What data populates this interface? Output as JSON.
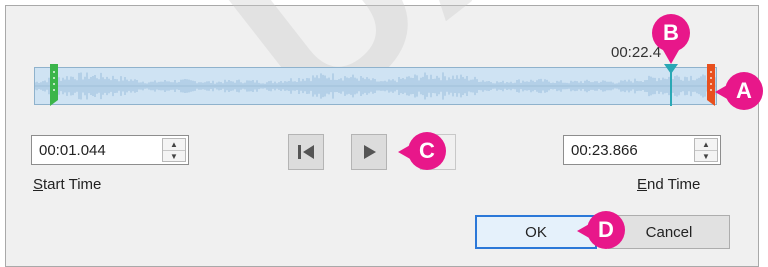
{
  "playback": {
    "current_time": "00:22.4"
  },
  "trim": {
    "start": {
      "value": "00:01.044",
      "label_mnemonic": "S",
      "label_rest": "tart Time"
    },
    "end": {
      "value": "00:23.866",
      "label_mnemonic": "E",
      "label_rest": "nd Time"
    }
  },
  "buttons": {
    "ok": "OK",
    "cancel": "Cancel"
  },
  "callouts": {
    "a": "A",
    "b": "B",
    "c": "C",
    "d": "D"
  },
  "colors": {
    "callout": "#e8178a",
    "start_marker": "#3bb54a",
    "end_marker": "#e8501e",
    "playhead": "#2aa8b5",
    "waveform": "#bcd8ee"
  },
  "icons": {
    "previous_frame": "skip-back-icon",
    "play": "play-icon",
    "spin_up": "triangle-up",
    "spin_down": "triangle-down"
  }
}
